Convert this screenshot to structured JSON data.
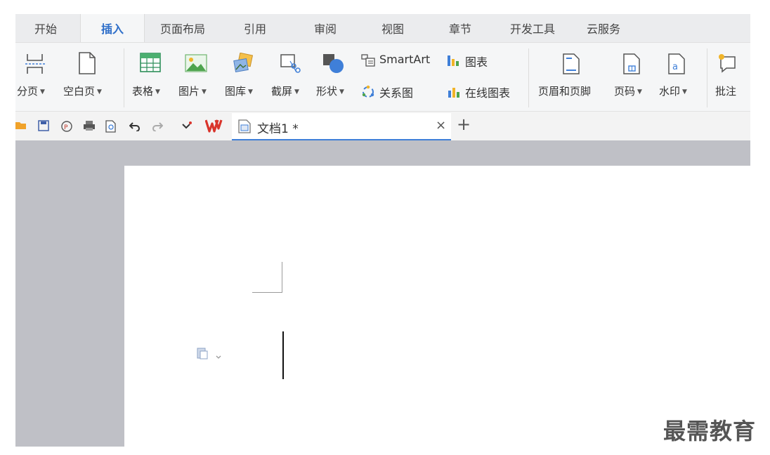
{
  "menu": {
    "tabs": [
      {
        "label": "开始"
      },
      {
        "label": "插入"
      },
      {
        "label": "页面布局"
      },
      {
        "label": "引用"
      },
      {
        "label": "审阅"
      },
      {
        "label": "视图"
      },
      {
        "label": "章节"
      },
      {
        "label": "开发工具"
      },
      {
        "label": "云服务"
      }
    ],
    "active": "插入"
  },
  "ribbon": {
    "page_break": "分页",
    "blank_page": "空白页",
    "table": "表格",
    "picture": "图片",
    "gallery": "图库",
    "screenshot": "截屏",
    "shape": "形状",
    "smartart": "SmartArt",
    "chart": "图表",
    "relation_chart": "关系图",
    "online_chart": "在线图表",
    "header_footer": "页眉和页脚",
    "page_number": "页码",
    "watermark": "水印",
    "comment": "批注",
    "dropdown_caret": "▼"
  },
  "tabs_bar": {
    "doc_title": "文档1 *",
    "close_glyph": "×",
    "new_tab_glyph": "+"
  },
  "overlay": {
    "watermark_text": "最需教育"
  },
  "colors": {
    "accent": "#2f6fc9",
    "workspace": "#bfc0c6",
    "wps_red": "#d9342b"
  }
}
